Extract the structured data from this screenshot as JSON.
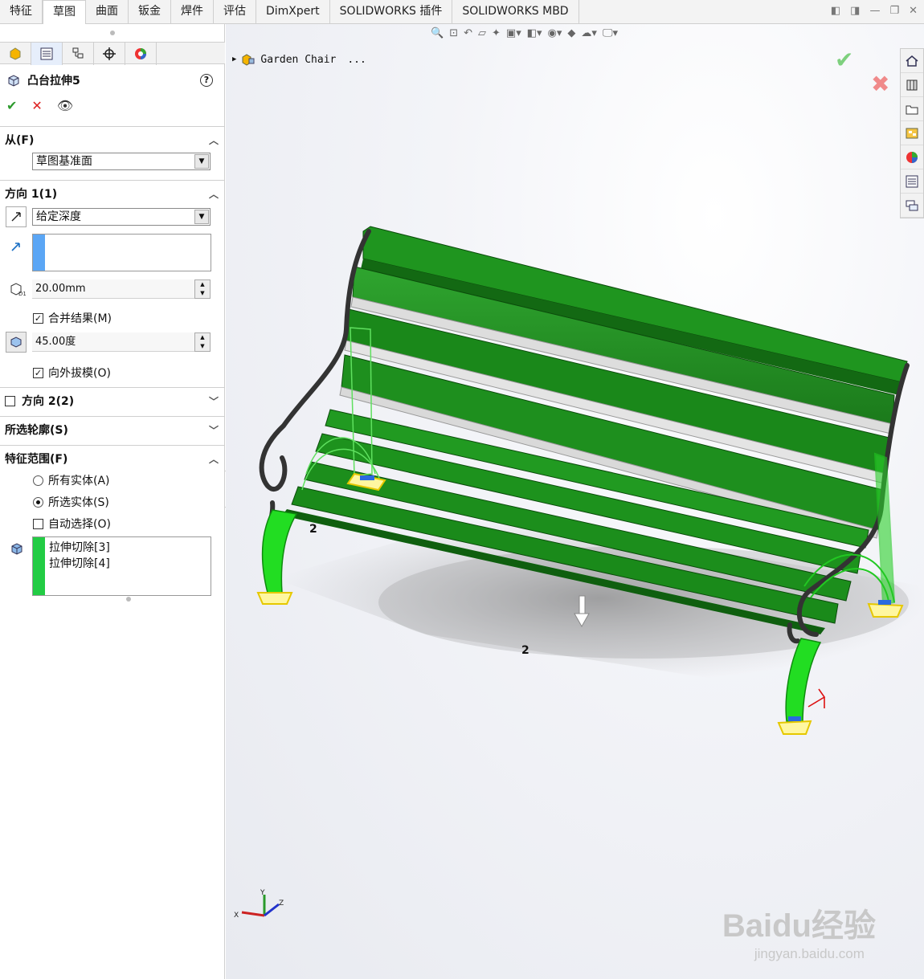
{
  "tabs": [
    "特征",
    "草图",
    "曲面",
    "钣金",
    "焊件",
    "评估",
    "DimXpert",
    "SOLIDWORKS 插件",
    "SOLIDWORKS MBD"
  ],
  "active_tab": 1,
  "feature": {
    "title": "凸台拉伸5",
    "help": "?",
    "ok_icon": "checkmark-icon",
    "cancel_icon": "x-icon",
    "preview_icon": "eye-icon"
  },
  "from": {
    "header": "从(F)",
    "value": "草图基准面"
  },
  "direction1": {
    "header": "方向 1(1)",
    "end_condition": "给定深度",
    "depth": "20.00mm",
    "merge_label": "合并结果(M)",
    "merge_checked": true,
    "draft_angle": "45.00度",
    "draft_out_label": "向外拔模(O)",
    "draft_out_checked": true
  },
  "direction2": {
    "header": "方向 2(2)",
    "checked": false
  },
  "contours": {
    "header": "所选轮廓(S)"
  },
  "scope": {
    "header": "特征范围(F)",
    "opt_all": "所有实体(A)",
    "opt_selected": "所选实体(S)",
    "auto_select": "自动选择(O)",
    "selected_option": "selected",
    "bodies": [
      "拉伸切除[3]",
      "拉伸切除[4]"
    ]
  },
  "viewport": {
    "tree_label": "Garden Chair",
    "tree_more": "...",
    "dim_label_1": "2",
    "dim_label_2": "2",
    "watermark": "Baidu经验",
    "watermark_url": "jingyan.baidu.com",
    "triad_x": "X",
    "triad_y": "Y",
    "triad_z": "Z"
  },
  "colors": {
    "bench_green": "#1f8a1f",
    "highlight_green": "#22dd22",
    "frame": "#3a3a3a",
    "ok_green": "#2e9b2e",
    "cancel_red": "#d22"
  }
}
